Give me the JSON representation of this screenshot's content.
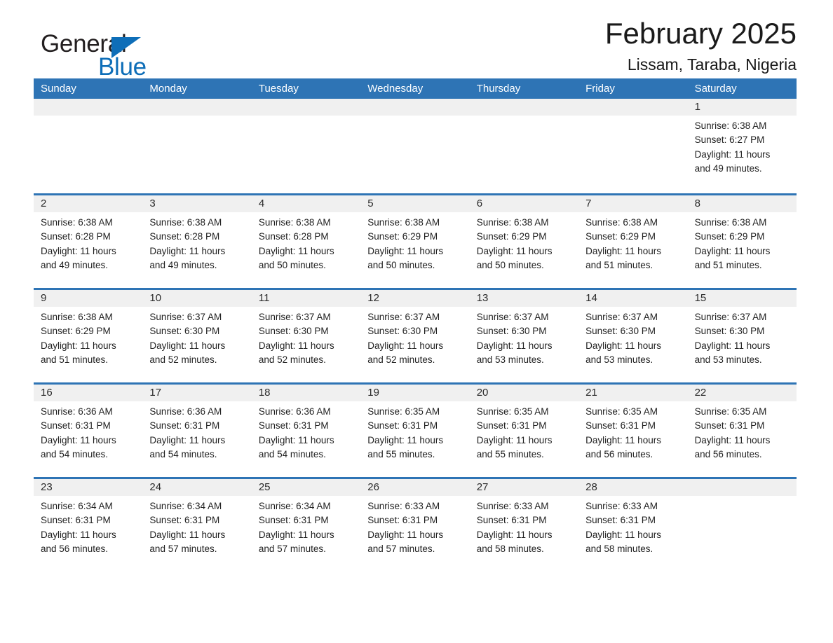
{
  "brand": {
    "name_dark": "General",
    "name_blue": "Blue",
    "accent_color": "#0e6eb8"
  },
  "header": {
    "month_title": "February 2025",
    "location": "Lissam, Taraba, Nigeria"
  },
  "theme": {
    "header_blue": "#2e74b5",
    "row_divider_blue": "#2e74b5",
    "daynum_band_gray": "#f0f0f0",
    "text_color": "#1f1f1f"
  },
  "weekdays": [
    "Sunday",
    "Monday",
    "Tuesday",
    "Wednesday",
    "Thursday",
    "Friday",
    "Saturday"
  ],
  "weeks": [
    [
      {
        "day": "",
        "blank": true
      },
      {
        "day": "",
        "blank": true
      },
      {
        "day": "",
        "blank": true
      },
      {
        "day": "",
        "blank": true
      },
      {
        "day": "",
        "blank": true
      },
      {
        "day": "",
        "blank": true
      },
      {
        "day": "1",
        "sunrise": "Sunrise: 6:38 AM",
        "sunset": "Sunset: 6:27 PM",
        "daylight1": "Daylight: 11 hours",
        "daylight2": "and 49 minutes."
      }
    ],
    [
      {
        "day": "2",
        "sunrise": "Sunrise: 6:38 AM",
        "sunset": "Sunset: 6:28 PM",
        "daylight1": "Daylight: 11 hours",
        "daylight2": "and 49 minutes."
      },
      {
        "day": "3",
        "sunrise": "Sunrise: 6:38 AM",
        "sunset": "Sunset: 6:28 PM",
        "daylight1": "Daylight: 11 hours",
        "daylight2": "and 49 minutes."
      },
      {
        "day": "4",
        "sunrise": "Sunrise: 6:38 AM",
        "sunset": "Sunset: 6:28 PM",
        "daylight1": "Daylight: 11 hours",
        "daylight2": "and 50 minutes."
      },
      {
        "day": "5",
        "sunrise": "Sunrise: 6:38 AM",
        "sunset": "Sunset: 6:29 PM",
        "daylight1": "Daylight: 11 hours",
        "daylight2": "and 50 minutes."
      },
      {
        "day": "6",
        "sunrise": "Sunrise: 6:38 AM",
        "sunset": "Sunset: 6:29 PM",
        "daylight1": "Daylight: 11 hours",
        "daylight2": "and 50 minutes."
      },
      {
        "day": "7",
        "sunrise": "Sunrise: 6:38 AM",
        "sunset": "Sunset: 6:29 PM",
        "daylight1": "Daylight: 11 hours",
        "daylight2": "and 51 minutes."
      },
      {
        "day": "8",
        "sunrise": "Sunrise: 6:38 AM",
        "sunset": "Sunset: 6:29 PM",
        "daylight1": "Daylight: 11 hours",
        "daylight2": "and 51 minutes."
      }
    ],
    [
      {
        "day": "9",
        "sunrise": "Sunrise: 6:38 AM",
        "sunset": "Sunset: 6:29 PM",
        "daylight1": "Daylight: 11 hours",
        "daylight2": "and 51 minutes."
      },
      {
        "day": "10",
        "sunrise": "Sunrise: 6:37 AM",
        "sunset": "Sunset: 6:30 PM",
        "daylight1": "Daylight: 11 hours",
        "daylight2": "and 52 minutes."
      },
      {
        "day": "11",
        "sunrise": "Sunrise: 6:37 AM",
        "sunset": "Sunset: 6:30 PM",
        "daylight1": "Daylight: 11 hours",
        "daylight2": "and 52 minutes."
      },
      {
        "day": "12",
        "sunrise": "Sunrise: 6:37 AM",
        "sunset": "Sunset: 6:30 PM",
        "daylight1": "Daylight: 11 hours",
        "daylight2": "and 52 minutes."
      },
      {
        "day": "13",
        "sunrise": "Sunrise: 6:37 AM",
        "sunset": "Sunset: 6:30 PM",
        "daylight1": "Daylight: 11 hours",
        "daylight2": "and 53 minutes."
      },
      {
        "day": "14",
        "sunrise": "Sunrise: 6:37 AM",
        "sunset": "Sunset: 6:30 PM",
        "daylight1": "Daylight: 11 hours",
        "daylight2": "and 53 minutes."
      },
      {
        "day": "15",
        "sunrise": "Sunrise: 6:37 AM",
        "sunset": "Sunset: 6:30 PM",
        "daylight1": "Daylight: 11 hours",
        "daylight2": "and 53 minutes."
      }
    ],
    [
      {
        "day": "16",
        "sunrise": "Sunrise: 6:36 AM",
        "sunset": "Sunset: 6:31 PM",
        "daylight1": "Daylight: 11 hours",
        "daylight2": "and 54 minutes."
      },
      {
        "day": "17",
        "sunrise": "Sunrise: 6:36 AM",
        "sunset": "Sunset: 6:31 PM",
        "daylight1": "Daylight: 11 hours",
        "daylight2": "and 54 minutes."
      },
      {
        "day": "18",
        "sunrise": "Sunrise: 6:36 AM",
        "sunset": "Sunset: 6:31 PM",
        "daylight1": "Daylight: 11 hours",
        "daylight2": "and 54 minutes."
      },
      {
        "day": "19",
        "sunrise": "Sunrise: 6:35 AM",
        "sunset": "Sunset: 6:31 PM",
        "daylight1": "Daylight: 11 hours",
        "daylight2": "and 55 minutes."
      },
      {
        "day": "20",
        "sunrise": "Sunrise: 6:35 AM",
        "sunset": "Sunset: 6:31 PM",
        "daylight1": "Daylight: 11 hours",
        "daylight2": "and 55 minutes."
      },
      {
        "day": "21",
        "sunrise": "Sunrise: 6:35 AM",
        "sunset": "Sunset: 6:31 PM",
        "daylight1": "Daylight: 11 hours",
        "daylight2": "and 56 minutes."
      },
      {
        "day": "22",
        "sunrise": "Sunrise: 6:35 AM",
        "sunset": "Sunset: 6:31 PM",
        "daylight1": "Daylight: 11 hours",
        "daylight2": "and 56 minutes."
      }
    ],
    [
      {
        "day": "23",
        "sunrise": "Sunrise: 6:34 AM",
        "sunset": "Sunset: 6:31 PM",
        "daylight1": "Daylight: 11 hours",
        "daylight2": "and 56 minutes."
      },
      {
        "day": "24",
        "sunrise": "Sunrise: 6:34 AM",
        "sunset": "Sunset: 6:31 PM",
        "daylight1": "Daylight: 11 hours",
        "daylight2": "and 57 minutes."
      },
      {
        "day": "25",
        "sunrise": "Sunrise: 6:34 AM",
        "sunset": "Sunset: 6:31 PM",
        "daylight1": "Daylight: 11 hours",
        "daylight2": "and 57 minutes."
      },
      {
        "day": "26",
        "sunrise": "Sunrise: 6:33 AM",
        "sunset": "Sunset: 6:31 PM",
        "daylight1": "Daylight: 11 hours",
        "daylight2": "and 57 minutes."
      },
      {
        "day": "27",
        "sunrise": "Sunrise: 6:33 AM",
        "sunset": "Sunset: 6:31 PM",
        "daylight1": "Daylight: 11 hours",
        "daylight2": "and 58 minutes."
      },
      {
        "day": "28",
        "sunrise": "Sunrise: 6:33 AM",
        "sunset": "Sunset: 6:31 PM",
        "daylight1": "Daylight: 11 hours",
        "daylight2": "and 58 minutes."
      },
      {
        "day": "",
        "blank": true
      }
    ]
  ]
}
